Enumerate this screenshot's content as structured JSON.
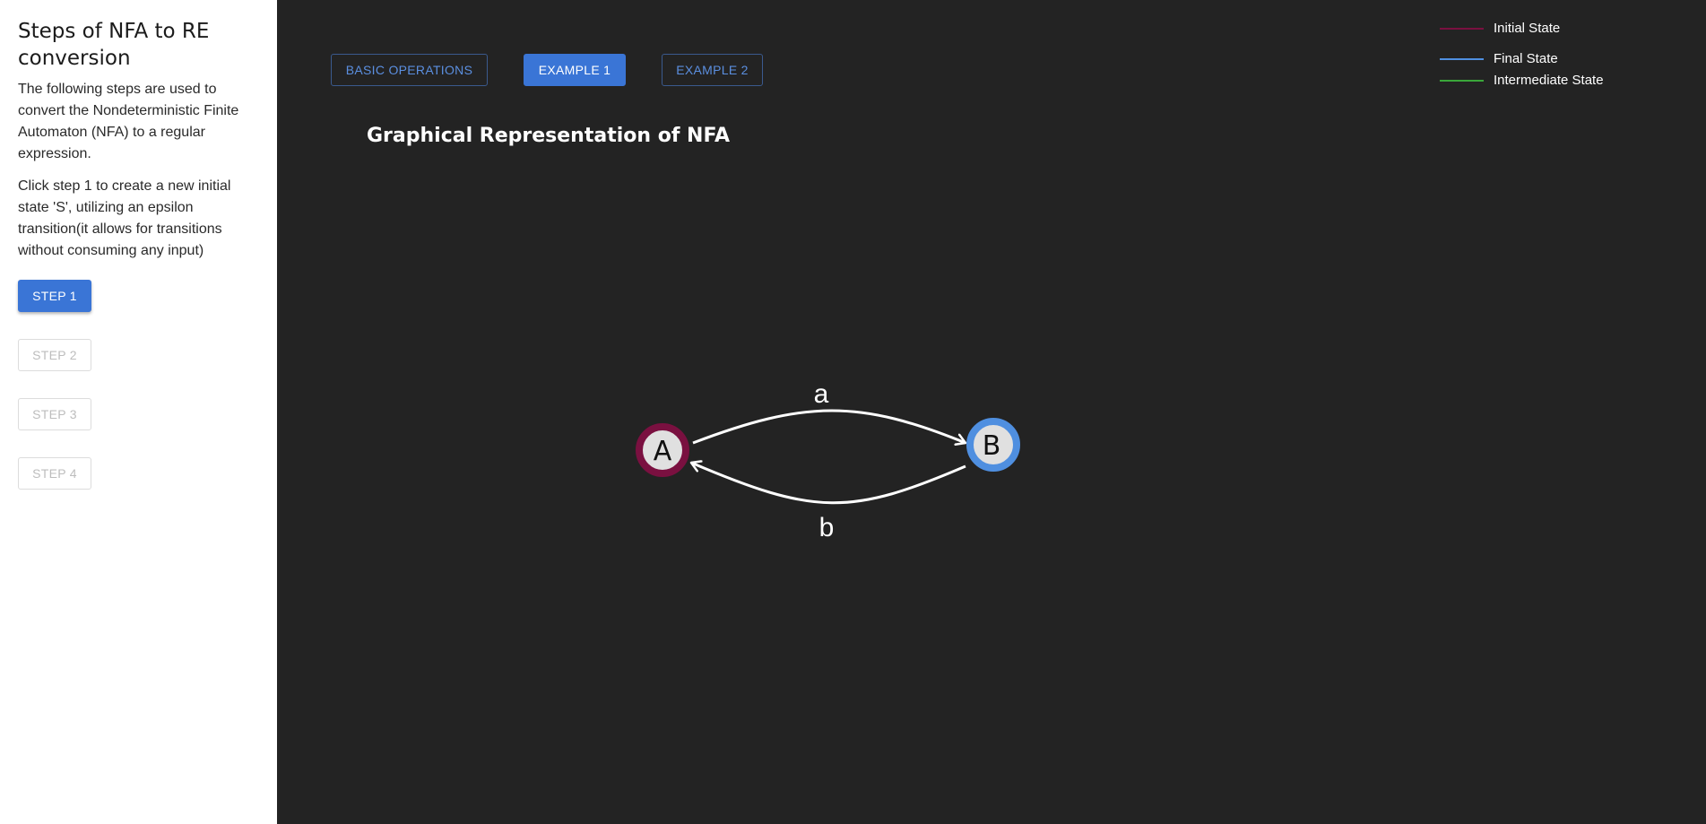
{
  "sidebar": {
    "title": "Steps of NFA to RE conversion",
    "intro": "The following steps are used to convert the Nondeterministic Finite Automaton (NFA) to a regular expression.",
    "instruction": "Click step 1 to create a new initial state 'S', utilizing an epsilon transition(it allows for transitions without consuming any input)",
    "steps": [
      {
        "label": "STEP 1",
        "enabled": true
      },
      {
        "label": "STEP 2",
        "enabled": false
      },
      {
        "label": "STEP 3",
        "enabled": false
      },
      {
        "label": "STEP 4",
        "enabled": false
      }
    ]
  },
  "tabs": [
    {
      "label": "BASIC OPERATIONS",
      "active": false
    },
    {
      "label": "EXAMPLE 1",
      "active": true
    },
    {
      "label": "EXAMPLE 2",
      "active": false
    }
  ],
  "graph": {
    "title": "Graphical Representation of NFA",
    "states": [
      {
        "label": "A",
        "type": "initial"
      },
      {
        "label": "B",
        "type": "final"
      }
    ],
    "transitions": [
      {
        "from": "A",
        "to": "B",
        "symbol": "a"
      },
      {
        "from": "B",
        "to": "A",
        "symbol": "b"
      }
    ]
  },
  "legend": [
    {
      "label": "Initial State",
      "color": "#7a1040"
    },
    {
      "label": "Final State",
      "color": "#4f8fe0"
    },
    {
      "label": "Intermediate State",
      "color": "#3aa63a"
    }
  ],
  "colors": {
    "accent": "#3a75d6",
    "background": "#232323",
    "initial": "#7a1040",
    "final": "#4f8fe0",
    "node_fill": "#e0e0e0"
  }
}
